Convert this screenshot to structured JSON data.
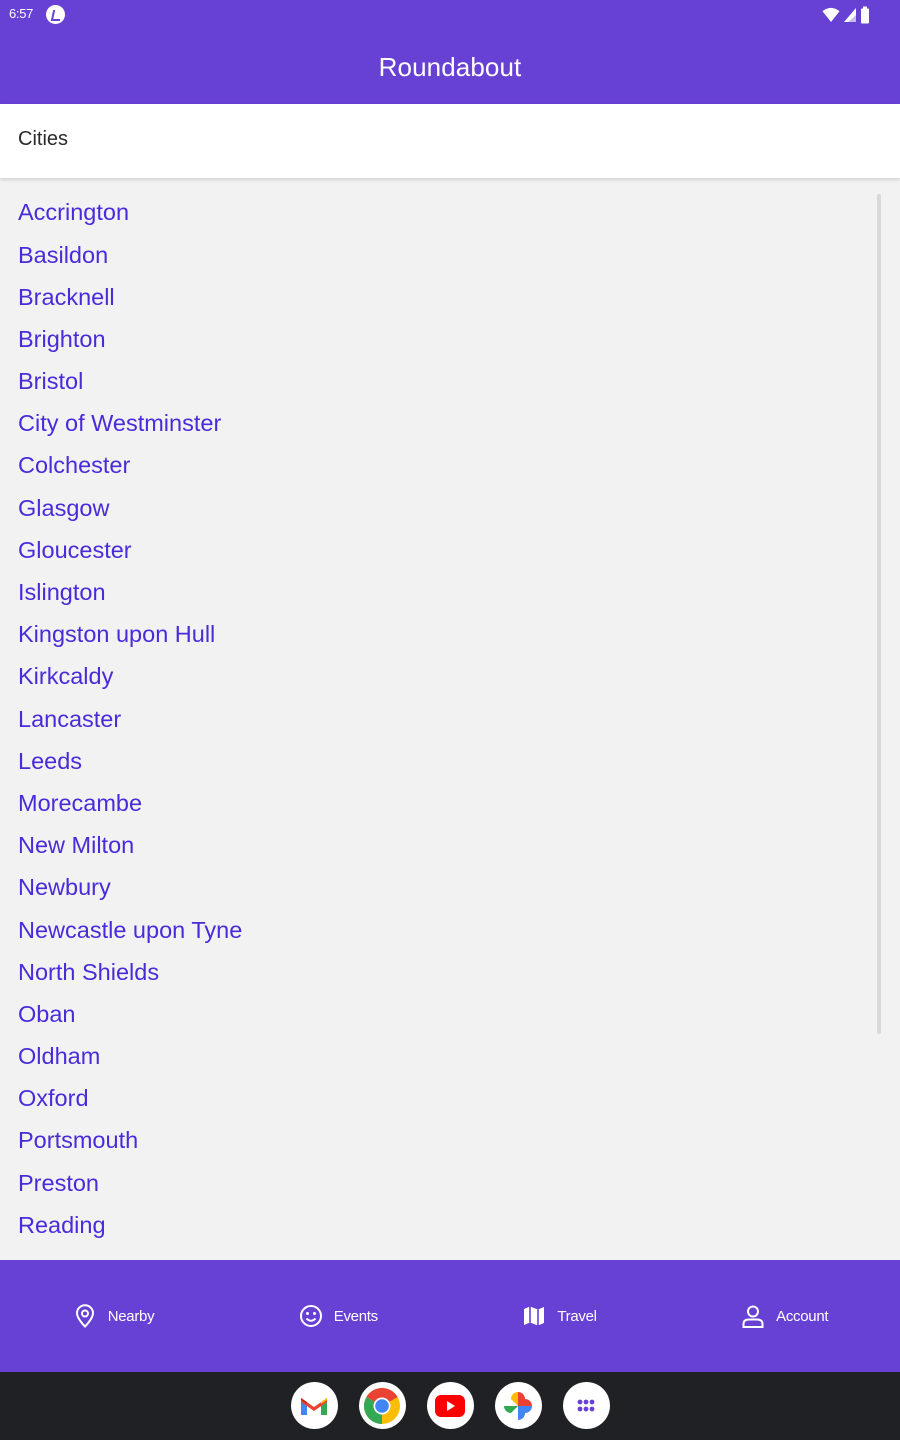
{
  "status_bar": {
    "time": "6:57"
  },
  "app": {
    "title": "Roundabout"
  },
  "section": {
    "title": "Cities"
  },
  "cities": [
    "Accrington",
    "Basildon",
    "Bracknell",
    "Brighton",
    "Bristol",
    "City of Westminster",
    "Colchester",
    "Glasgow",
    "Gloucester",
    "Islington",
    "Kingston upon Hull",
    "Kirkcaldy",
    "Lancaster",
    "Leeds",
    "Morecambe",
    "New Milton",
    "Newbury",
    "Newcastle upon Tyne",
    "North Shields",
    "Oban",
    "Oldham",
    "Oxford",
    "Portsmouth",
    "Preston",
    "Reading"
  ],
  "bottom_nav": {
    "items": [
      {
        "label": "Nearby",
        "icon": "location-pin-icon"
      },
      {
        "label": "Events",
        "icon": "smiley-icon"
      },
      {
        "label": "Travel",
        "icon": "map-icon"
      },
      {
        "label": "Account",
        "icon": "person-icon"
      }
    ]
  },
  "dock_apps": [
    {
      "name": "gmail",
      "icon": "gmail-icon"
    },
    {
      "name": "chrome",
      "icon": "chrome-icon"
    },
    {
      "name": "youtube",
      "icon": "youtube-icon"
    },
    {
      "name": "photos",
      "icon": "photos-icon"
    },
    {
      "name": "app-drawer",
      "icon": "app-drawer-icon"
    }
  ],
  "colors": {
    "primary": "#6740d4",
    "link": "#4a2bd9",
    "background": "#f2f2f2",
    "surface": "#ffffff",
    "system_bar": "#202124"
  }
}
